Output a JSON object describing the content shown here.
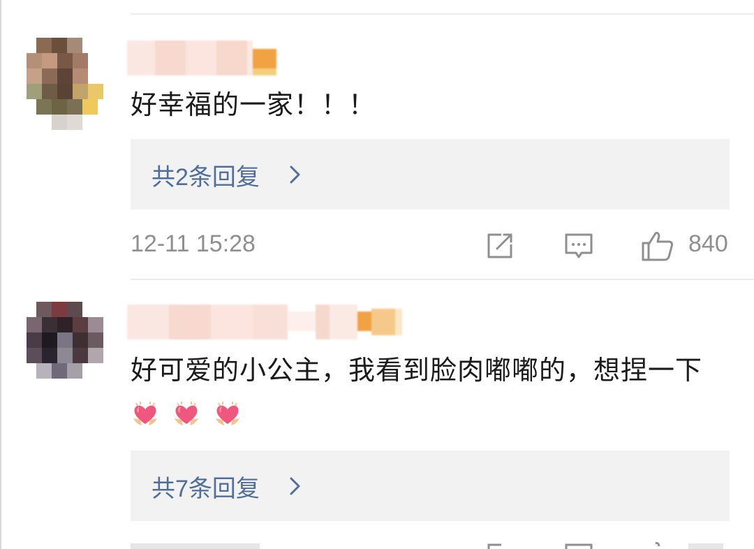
{
  "comments": [
    {
      "text": "好幸福的一家！！！",
      "replies_label": "共2条回复",
      "timestamp": "12-11 15:28",
      "likes": "840",
      "icons": [
        "share-icon",
        "comment-icon",
        "like-icon"
      ]
    },
    {
      "text": "好可爱的小公主，我看到脸肉嘟嘟的，想捏一下",
      "emoji": [
        "heart-hands-emoji",
        "heart-hands-emoji",
        "heart-hands-emoji"
      ],
      "replies_label": "共7条回复",
      "timestamp": "",
      "likes": ""
    }
  ],
  "colors": {
    "reply_link": "#4f6e99",
    "meta_text": "#8f8f8f",
    "reply_background": "#f2f2f2"
  }
}
